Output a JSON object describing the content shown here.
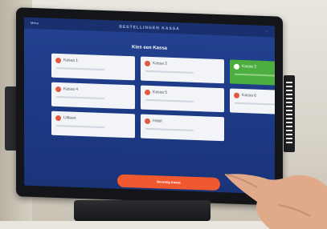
{
  "app": {
    "title": "BESTELLINGEN KASSA",
    "back_label": "Menu",
    "menu_label": "···"
  },
  "page": {
    "heading": "Kies een Kassa"
  },
  "tiles": [
    {
      "label": "Kassa 1",
      "selected": false
    },
    {
      "label": "Kassa 2",
      "selected": false
    },
    {
      "label": "Kassa 3",
      "selected": true
    },
    {
      "label": "Kassa 4",
      "selected": false
    },
    {
      "label": "Kassa 5",
      "selected": false
    },
    {
      "label": "Kassa 6",
      "selected": false
    },
    {
      "label": "Uitleen",
      "selected": false
    },
    {
      "label": "Hotel",
      "selected": false
    }
  ],
  "cta": {
    "label": "Bevestig Kassa"
  },
  "colors": {
    "screen_bg": "#1d3a86",
    "tile_bg": "#f2f4f8",
    "selected": "#4cae3e",
    "accent": "#f0592f",
    "status_dot": "#e25b3f"
  },
  "icons": {
    "tile_status": "status-dot-icon",
    "selected_mark": "check-icon"
  }
}
